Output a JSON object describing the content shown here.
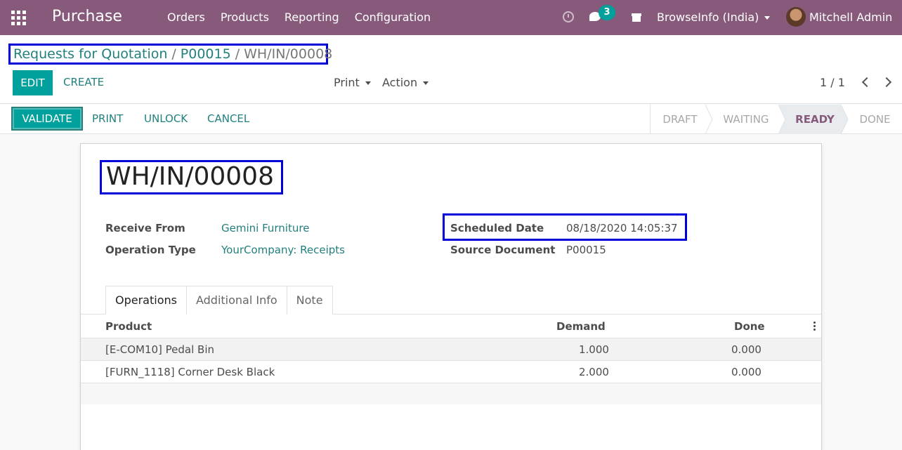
{
  "navbar": {
    "app_title": "Purchase",
    "menu": [
      "Orders",
      "Products",
      "Reporting",
      "Configuration"
    ],
    "message_count": "3",
    "company": "BrowseInfo (India)",
    "user": "Mitchell Admin",
    "brand_color": "#875a7b"
  },
  "breadcrumb": {
    "items": [
      "Requests for Quotation",
      "P00015"
    ],
    "current": "WH/IN/00008",
    "separator": "/"
  },
  "control": {
    "edit_label": "EDIT",
    "create_label": "CREATE",
    "print_label": "Print",
    "action_label": "Action",
    "pager": "1 / 1"
  },
  "statusbar": {
    "buttons": [
      "VALIDATE",
      "PRINT",
      "UNLOCK",
      "CANCEL"
    ],
    "stages": [
      "DRAFT",
      "WAITING",
      "READY",
      "DONE"
    ],
    "active_stage": "READY"
  },
  "form": {
    "name": "WH/IN/00008",
    "receive_from_label": "Receive From",
    "receive_from": "Gemini Furniture",
    "operation_type_label": "Operation Type",
    "operation_type": "YourCompany: Receipts",
    "scheduled_date_label": "Scheduled Date",
    "scheduled_date": "08/18/2020 14:05:37",
    "source_document_label": "Source Document",
    "source_document": "P00015"
  },
  "tabs": [
    "Operations",
    "Additional Info",
    "Note"
  ],
  "table": {
    "columns": [
      "Product",
      "Demand",
      "Done"
    ],
    "rows": [
      {
        "product": "[E-COM10] Pedal Bin",
        "demand": "1.000",
        "done": "0.000"
      },
      {
        "product": "[FURN_1118] Corner Desk Black",
        "demand": "2.000",
        "done": "0.000"
      }
    ]
  }
}
